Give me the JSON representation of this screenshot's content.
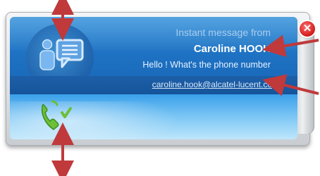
{
  "notification": {
    "title": "Instant message from",
    "sender_name": "Caroline HOOK",
    "message_preview": "Hello ! What's the phone number",
    "email": "caroline.hook@alcatel-lucent.co"
  },
  "icons": {
    "contact": "contact-person-icon",
    "chat": "chat-bubble-icon",
    "phone": "phone-callback-icon",
    "close": "close-icon"
  },
  "colors": {
    "panel_blue": "#1f73c4",
    "annotation_arrow": "#c0393b",
    "close_red": "#d21b1b",
    "phone_green": "#6cbf3a"
  }
}
